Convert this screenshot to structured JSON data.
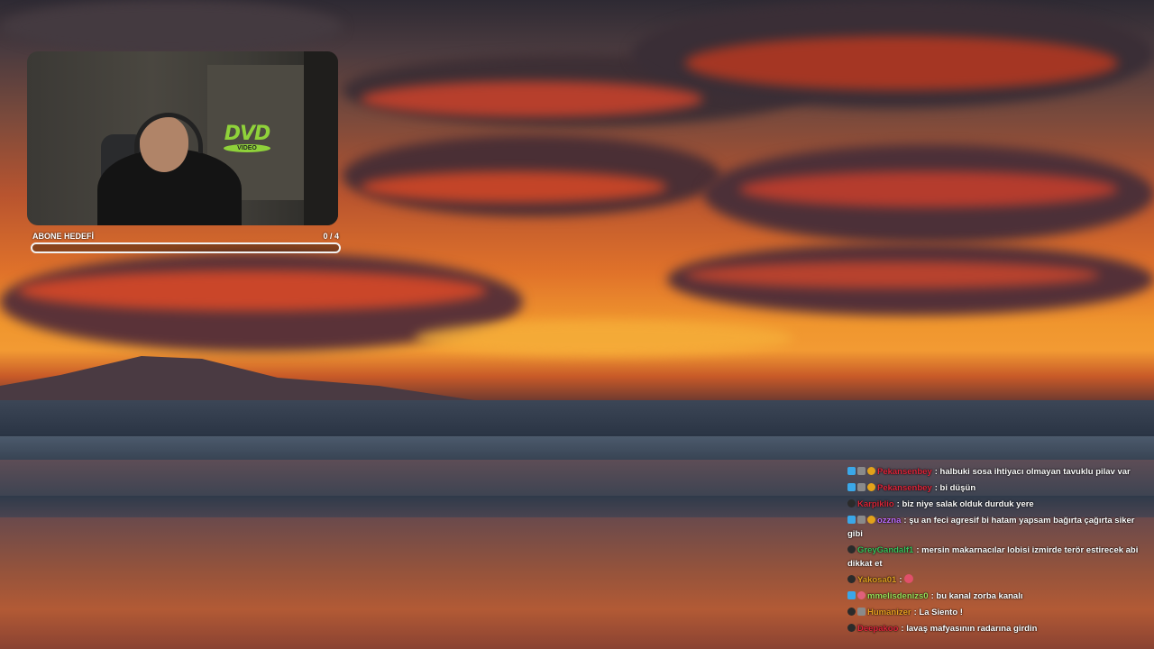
{
  "overlay": {
    "goal_label": "ABONE HEDEFİ",
    "goal_count": "0 / 4",
    "goal_progress": 0,
    "dvd_logo": "DVD",
    "dvd_sub": "VIDEO"
  },
  "chat": {
    "messages": [
      {
        "badges": [
          "blue",
          "grey",
          "gold"
        ],
        "user": "Pekansenbey",
        "user_color": "#e0263c",
        "text": "halbuki sosa ihtiyacı olmayan tavuklu pilav var"
      },
      {
        "badges": [
          "blue",
          "grey",
          "gold"
        ],
        "user": "Pekansenbey",
        "user_color": "#e0263c",
        "text": "bi düşün"
      },
      {
        "badges": [
          "dark"
        ],
        "user": "Karpiklio",
        "user_color": "#d82638",
        "text": "biz niye salak olduk durduk yere"
      },
      {
        "badges": [
          "blue",
          "grey",
          "gold"
        ],
        "user": "ozzna",
        "user_color": "#b96bff",
        "text": "şu an feci agresif bi hatam yapsam bağırta çağırta siker gibi"
      },
      {
        "badges": [
          "dark"
        ],
        "user": "GreyGandalf1",
        "user_color": "#38c25c",
        "text": "mersin makarnacılar lobisi izmirde terör estirecek abi dikkat et"
      },
      {
        "badges": [
          "dark"
        ],
        "user": "Yakosa01",
        "user_color": "#e0a020",
        "text": "",
        "emote": true
      },
      {
        "badges": [
          "blue",
          "pink"
        ],
        "user": "mmelisdenizs0",
        "user_color": "#9be35a",
        "text": "bu kanal zorba kanalı"
      },
      {
        "badges": [
          "dark",
          "grey"
        ],
        "user": "Humanizer",
        "user_color": "#e8a020",
        "text": "La Siento !"
      },
      {
        "badges": [
          "dark"
        ],
        "user": "Deepakoo",
        "user_color": "#e0263c",
        "text": "lavaş mafyasının radarına girdin"
      }
    ]
  }
}
